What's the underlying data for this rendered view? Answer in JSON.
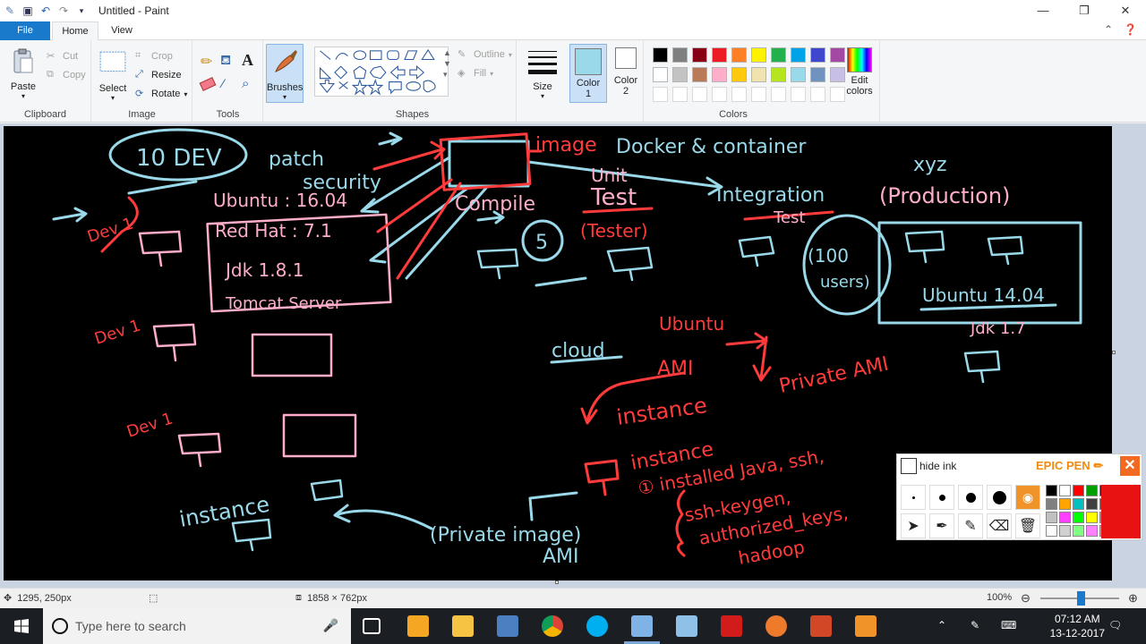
{
  "window": {
    "title": "Untitled - Paint",
    "controls": {
      "minimize": "—",
      "maximize": "❐",
      "close": "✕"
    }
  },
  "tabs": {
    "file": "File",
    "home": "Home",
    "view": "View"
  },
  "ribbon": {
    "clipboard": {
      "label": "Clipboard",
      "paste": "Paste",
      "cut": "Cut",
      "copy": "Copy"
    },
    "image": {
      "label": "Image",
      "select": "Select",
      "crop": "Crop",
      "resize": "Resize",
      "rotate": "Rotate"
    },
    "tools": {
      "label": "Tools"
    },
    "brushes": {
      "label": "Brushes"
    },
    "shapes": {
      "label": "Shapes",
      "outline": "Outline",
      "fill": "Fill"
    },
    "size": {
      "label": "Size"
    },
    "color1": {
      "label": "Color",
      "sub": "1"
    },
    "color2": {
      "label": "Color",
      "sub": "2"
    },
    "colors": {
      "label": "Colors",
      "edit_label": "Edit",
      "edit_sub": "colors",
      "row1": [
        "#000000",
        "#7f7f7f",
        "#880015",
        "#ed1c24",
        "#ff7f27",
        "#fff200",
        "#22b14c",
        "#00a2e8",
        "#3f48cc",
        "#a349a4"
      ],
      "row2": [
        "#ffffff",
        "#c3c3c3",
        "#b97a57",
        "#ffaec9",
        "#ffc90e",
        "#efe4b0",
        "#b5e61d",
        "#99d9ea",
        "#7092be",
        "#c8bfe7"
      ],
      "color1_value": "#99d9ea",
      "color2_value": "#ffffff"
    }
  },
  "canvas": {
    "annotations": {
      "dev10": "10 DEV",
      "patch": "patch",
      "security": "security",
      "image": "image",
      "docker": "Docker & container",
      "ubuntu_1604": "Ubuntu : 16.04",
      "unit": "Unit",
      "test": "Test",
      "integration": "Integration",
      "test2": "Test",
      "xyz": "xyz",
      "production": "(Production)",
      "dev1a": "Dev 1",
      "redhat": "Red Hat : 7.1",
      "jdk": "Jdk 1.8.1",
      "tomcat": "Tomcat Server",
      "compile": "Compile",
      "five": "5",
      "tester": "(Tester)",
      "users100": "(100",
      "users": "users)",
      "ubuntu1404": "Ubuntu 14.04",
      "jdk17": "Jdk 1.7",
      "dev1b": "Dev 1",
      "ubuntu": "Ubuntu",
      "cloud": "cloud",
      "ami": "AMI",
      "private_ami": "Private AMI",
      "instance_red": "instance",
      "dev1c": "Dev 1",
      "instance2": "instance",
      "installed": "① installed Java, ssh,",
      "sshkeygen": "ssh-keygen,",
      "authorized": "authorized_keys,",
      "hadoop": "hadoop",
      "instance_blue": "instance",
      "private_image": "(Private image)",
      "ami2": "AMI"
    }
  },
  "epic_pen": {
    "hide_ink": "hide ink",
    "brand": "EPIC PEN",
    "close": "✕",
    "current_color": "#e81212",
    "palette": [
      "#000000",
      "#ffffff",
      "#ff0000",
      "#00a000",
      "#0000ff",
      "#808080",
      "#ffa500",
      "#00c0c0",
      "#404040",
      "#8b4513",
      "#c0c0c0",
      "#ff40ff",
      "#00ff00",
      "#ffff00",
      "#8080ff",
      "#ffffff",
      "#d0d0d0",
      "#80ff80",
      "#ff80ff",
      "#ff8080"
    ]
  },
  "status": {
    "cursor_pos": "1295, 250px",
    "image_size": "1858 × 762px",
    "zoom": "100%"
  },
  "taskbar": {
    "search_placeholder": "Type here to search",
    "time": "07:12 AM",
    "date": "13-12-2017"
  }
}
